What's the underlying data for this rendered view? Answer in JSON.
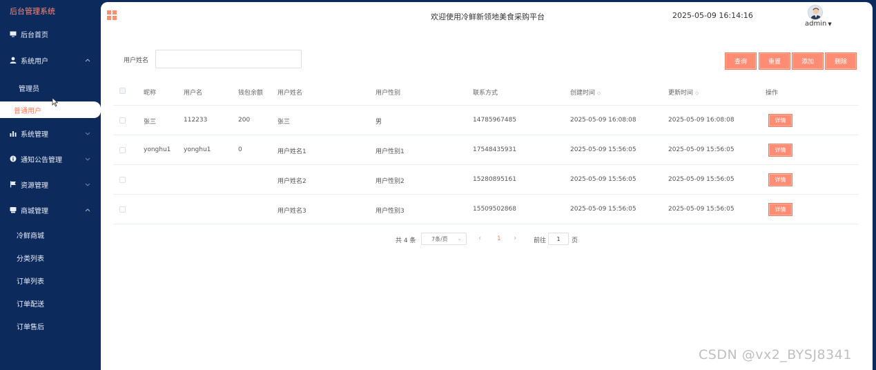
{
  "sidebar": {
    "brand": "后台管理系统",
    "items": [
      {
        "label": "后台首页",
        "icon": "monitor-icon"
      },
      {
        "label": "系统用户",
        "icon": "user-icon",
        "expanded": true
      },
      {
        "label": "系统管理",
        "icon": "bar-chart-icon"
      },
      {
        "label": "通知公告管理",
        "icon": "info-icon"
      },
      {
        "label": "资源管理",
        "icon": "flag-icon"
      },
      {
        "label": "商城管理",
        "icon": "store-icon",
        "expanded": true
      }
    ],
    "sub_users": [
      "管理员",
      "普通用户"
    ],
    "sub_mall": [
      "冷鲜商城",
      "分类列表",
      "订单列表",
      "订单配送",
      "订单售后"
    ]
  },
  "header": {
    "welcome": "欢迎使用冷鲜新领地美食采购平台",
    "datetime": "2025-05-09 16:14:16",
    "user": "admin"
  },
  "search": {
    "label": "用户姓名",
    "value": ""
  },
  "actions": {
    "query": "查询",
    "reset": "重置",
    "add": "添加",
    "delete": "删除"
  },
  "table": {
    "columns": [
      "昵称",
      "用户名",
      "钱包余额",
      "用户姓名",
      "用户性别",
      "联系方式",
      "创建时间",
      "更新时间",
      "操作"
    ],
    "rows": [
      {
        "nickname": "张三",
        "username": "112233",
        "balance": "200",
        "name": "张三",
        "gender": "男",
        "phone": "14785967485",
        "created": "2025-05-09 16:08:08",
        "updated": "2025-05-09 16:08:08",
        "action": "详情"
      },
      {
        "nickname": "yonghu1",
        "username": "yonghu1",
        "balance": "0",
        "name": "用户姓名1",
        "gender": "用户性别1",
        "phone": "17548435931",
        "created": "2025-05-09 15:56:05",
        "updated": "2025-05-09 15:56:05",
        "action": "详情"
      },
      {
        "nickname": "",
        "username": "",
        "balance": "",
        "name": "用户姓名2",
        "gender": "用户性别2",
        "phone": "15280895161",
        "created": "2025-05-09 15:56:05",
        "updated": "2025-05-09 15:56:05",
        "action": "详情"
      },
      {
        "nickname": "",
        "username": "",
        "balance": "",
        "name": "用户姓名3",
        "gender": "用户性别3",
        "phone": "15509502868",
        "created": "2025-05-09 15:56:05",
        "updated": "2025-05-09 15:56:05",
        "action": "详情"
      }
    ]
  },
  "pagination": {
    "total": "共 4 条",
    "page_size": "7条/页",
    "prev": "‹",
    "current": "1",
    "next": "›",
    "goto_label": "前往",
    "goto_value": "1",
    "page_suffix": "页"
  },
  "watermark": "CSDN @vx2_BYSJ8341",
  "colors": {
    "sidebar_bg": "#0d2a5c",
    "accent": "#ff8c73",
    "brand": "#ff8a73"
  }
}
